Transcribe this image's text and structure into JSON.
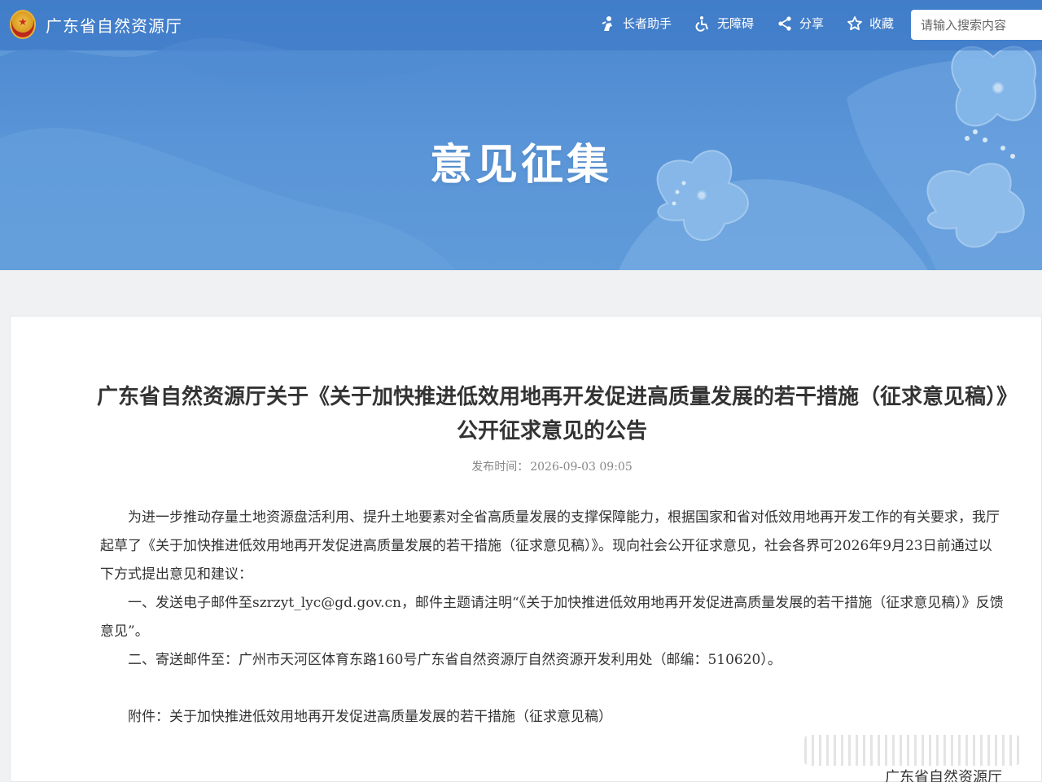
{
  "site": {
    "name": "广东省自然资源厅",
    "logo_icon": "national-emblem-icon"
  },
  "toolbar": {
    "items": [
      {
        "label": "长者助手",
        "icon": "elder-assist-icon"
      },
      {
        "label": "无障碍",
        "icon": "accessibility-icon"
      },
      {
        "label": "分享",
        "icon": "share-icon"
      },
      {
        "label": "收藏",
        "icon": "star-icon"
      }
    ],
    "search_placeholder": "请输入搜索内容"
  },
  "banner": {
    "title": "意见征集"
  },
  "article": {
    "title": "广东省自然资源厅关于《关于加快推进低效用地再开发促进高质量发展的若干措施（征求意见稿）》公开征求意见的公告",
    "publish_label": "发布时间：",
    "publish_time": "2026-09-03 09:05",
    "paragraphs": [
      "为进一步推动存量土地资源盘活利用、提升土地要素对全省高质量发展的支撑保障能力，根据国家和省对低效用地再开发工作的有关要求，我厅起草了《关于加快推进低效用地再开发促进高质量发展的若干措施（征求意见稿）》。现向社会公开征求意见，社会各界可2026年9月23日前通过以下方式提出意见和建议：",
      "一、发送电子邮件至szrzyt_lyc@gd.gov.cn，邮件主题请注明“《关于加快推进低效用地再开发促进高质量发展的若干措施（征求意见稿）》反馈意见”。",
      "二、寄送邮件至：广州市天河区体育东路160号广东省自然资源厅自然资源开发利用处（邮编：510620）。",
      "附件：关于加快推进低效用地再开发促进高质量发展的若干措施（征求意见稿）"
    ],
    "signature": "广东省自然资源厅"
  },
  "colors": {
    "banner": "#5a95d8",
    "card_bg": "#ffffff",
    "page_bg": "#f0f1f3"
  }
}
